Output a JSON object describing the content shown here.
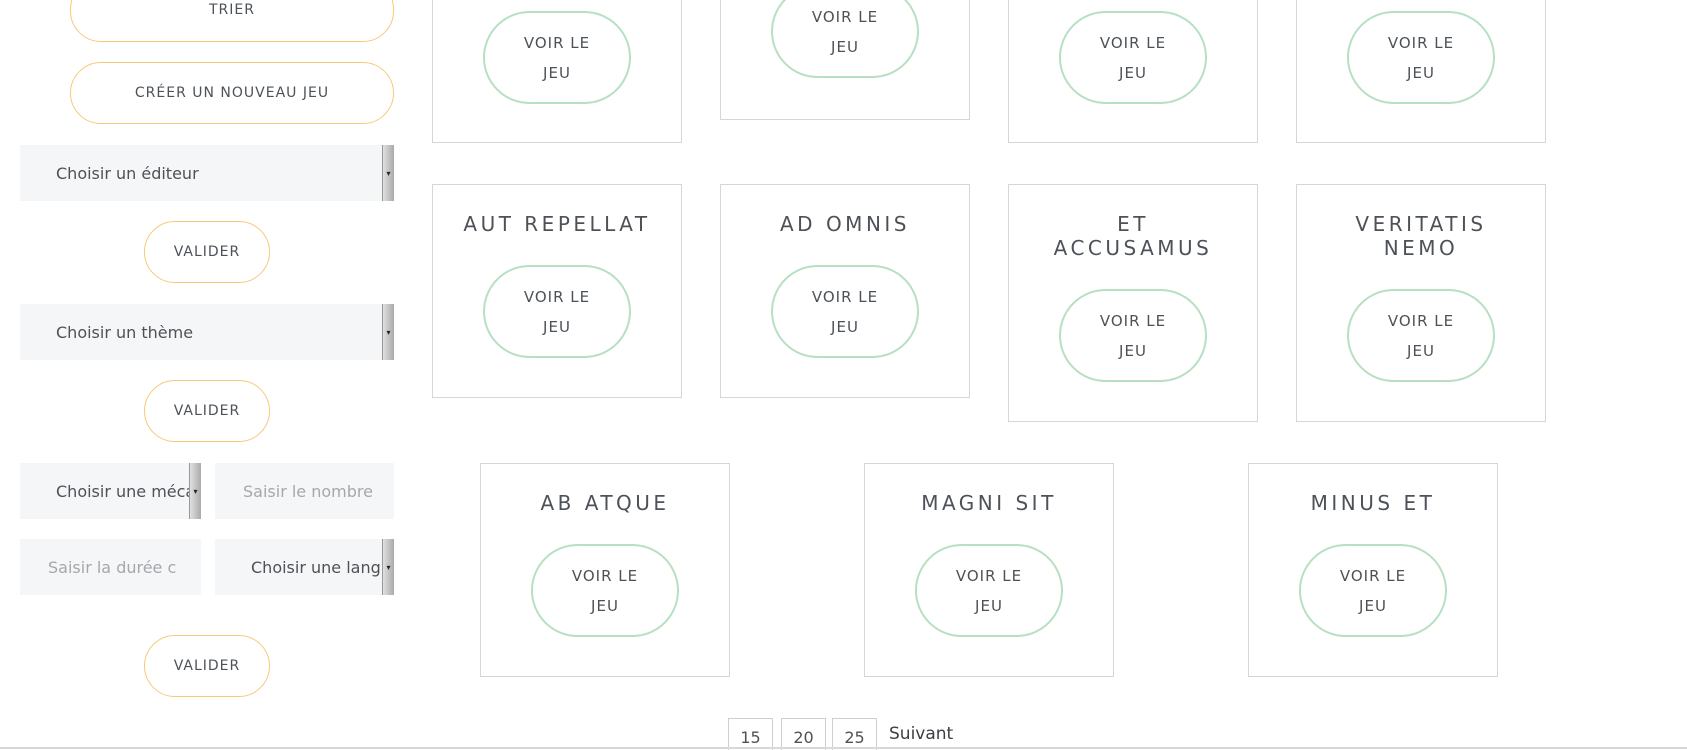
{
  "sidebar": {
    "sort_label": "TRIER",
    "create_label": "CRÉER UN NOUVEAU JEU",
    "publisher_select": "Choisir un éditeur",
    "validate_1": "VALIDER",
    "theme_select": "Choisir un thème",
    "validate_2": "VALIDER",
    "mechanic_select": "Choisir une méca",
    "players_placeholder": "Saisir le nombre",
    "duration_placeholder": "Saisir la durée c",
    "language_select": "Choisir une langu",
    "validate_3": "VALIDER"
  },
  "cards": {
    "view_line1": "VOIR LE",
    "view_line2": "JEU",
    "row2": [
      {
        "title": "AUT REPELLAT"
      },
      {
        "title": "AD OMNIS"
      },
      {
        "title_l1": "ET",
        "title_l2": "ACCUSAMUS"
      },
      {
        "title_l1": "VERITATIS",
        "title_l2": "NEMO"
      }
    ],
    "row3": [
      {
        "title": "AB ATQUE"
      },
      {
        "title": "MAGNI SIT"
      },
      {
        "title": "MINUS ET"
      }
    ]
  },
  "pagination": {
    "pages": [
      "15",
      "20",
      "25"
    ],
    "next_label": "Suivant"
  },
  "colors": {
    "orange_border": "#f8c878",
    "green_border": "#b7e0c3",
    "input_bg": "#f5f6f7"
  }
}
